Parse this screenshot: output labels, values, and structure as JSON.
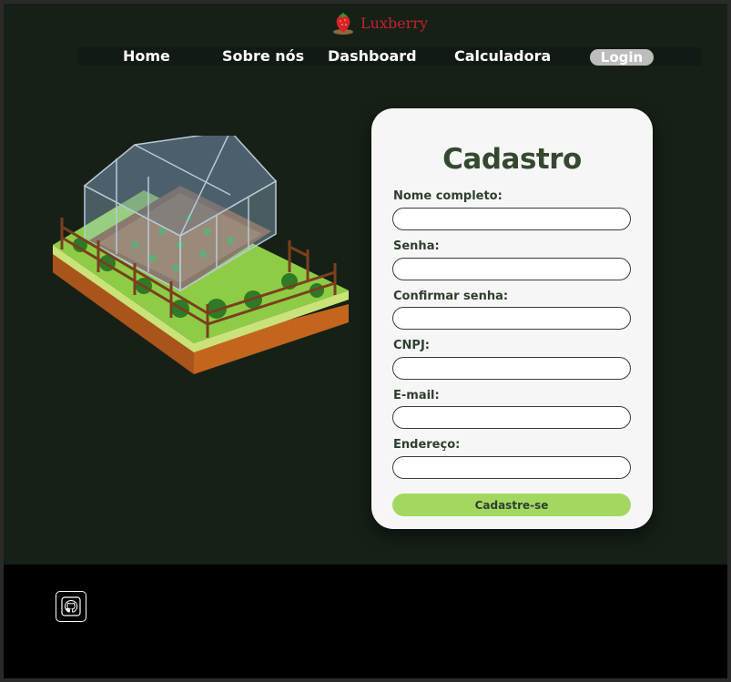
{
  "header": {
    "brand_name": "Luxberry",
    "brand_icon": "strawberry-icon",
    "nav": {
      "home": "Home",
      "about": "Sobre nós",
      "dashboard": "Dashboard",
      "calculator": "Calculadora",
      "login": "Login"
    }
  },
  "illustration": "greenhouse-illustration",
  "form": {
    "title": "Cadastro",
    "fields": [
      {
        "label": "Nome completo:",
        "value": "",
        "placeholder": ""
      },
      {
        "label": "Senha:",
        "value": "",
        "placeholder": ""
      },
      {
        "label": "Confirmar senha:",
        "value": "",
        "placeholder": ""
      },
      {
        "label": "CNPJ:",
        "value": "",
        "placeholder": ""
      },
      {
        "label": "E-mail:",
        "value": "",
        "placeholder": ""
      },
      {
        "label": "Endereço:",
        "value": "",
        "placeholder": ""
      }
    ],
    "submit_label": "Cadastre-se"
  },
  "footer": {
    "github_icon": "github-icon"
  },
  "colors": {
    "page_bg": "#162017",
    "brand": "#c0232c",
    "title": "#34492f",
    "button": "#a3d860",
    "footer": "#000000"
  }
}
